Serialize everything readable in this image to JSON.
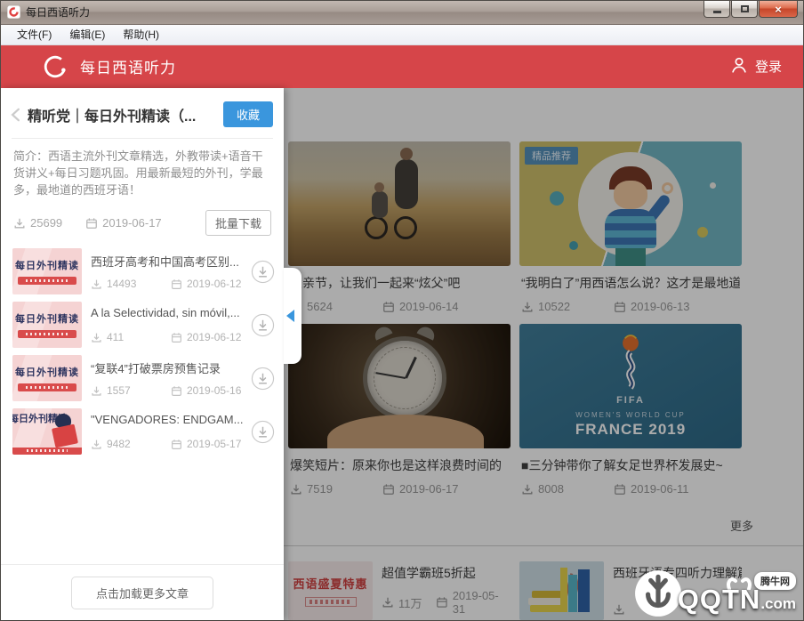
{
  "window": {
    "title": "每日西语听力",
    "menu": [
      "文件(F)",
      "编辑(E)",
      "帮助(H)"
    ]
  },
  "header": {
    "app_title": "每日西语听力",
    "login_label": "登录"
  },
  "panel": {
    "title": "精听党｜每日外刊精读（...",
    "favorite_label": "收藏",
    "description": "简介：西语主流外刊文章精选，外教带读+语音干货讲义+每日习题巩固。用最新最短的外刊，学最多，最地道的西班牙语！",
    "downloads": "25699",
    "date": "2019-06-17",
    "batch_download_label": "批量下载",
    "items": [
      {
        "title": "西班牙高考和中国高考区别...",
        "downloads": "14493",
        "date": "2019-06-12",
        "thumb_text": "每日外刊精读"
      },
      {
        "title": "A la Selectividad, sin móvil,...",
        "downloads": "411",
        "date": "2019-06-12",
        "thumb_text": "每日外刊精读"
      },
      {
        "title": "“复联4”打破票房预售记录",
        "downloads": "1557",
        "date": "2019-05-16",
        "thumb_text": "每日外刊精读"
      },
      {
        "title": "\"VENGADORES: ENDGAM...",
        "downloads": "9482",
        "date": "2019-05-17",
        "thumb_text": "每日外刊精读"
      }
    ],
    "load_more_label": "点击加载更多文章"
  },
  "main": {
    "cards": [
      {
        "caption": "父亲节，让我们一起来“炫父”吧",
        "downloads": "5624",
        "date": "2019-06-14"
      },
      {
        "caption": "“我明白了”用西语怎么说？这才是最地道的...",
        "downloads": "10522",
        "date": "2019-06-13",
        "badge": "精品推荐"
      },
      {
        "caption": "爆笑短片：原来你也是这样浪费时间的",
        "downloads": "7519",
        "date": "2019-06-17"
      },
      {
        "caption": "■三分钟带你了解女足世界杯发展史~",
        "downloads": "8008",
        "date": "2019-06-11",
        "img_fifa": "FIFA",
        "img_line1": "WOMEN'S WORLD CUP",
        "img_line2": "FRANCE 2019"
      }
    ],
    "more_label": "更多",
    "bottom_items": [
      {
        "caption": "超值学霸班5折起",
        "downloads": "11万",
        "date": "2019-05-31",
        "thumb_text": "西语盛夏特惠"
      },
      {
        "caption": "西班牙语专四听力理解篇",
        "downloads": ""
      }
    ]
  },
  "watermark": {
    "brand": "QQTN",
    "suffix": ".com",
    "bubble": "腾牛网"
  },
  "colors": {
    "accent_red": "#d64549",
    "accent_blue": "#3a96dd"
  }
}
